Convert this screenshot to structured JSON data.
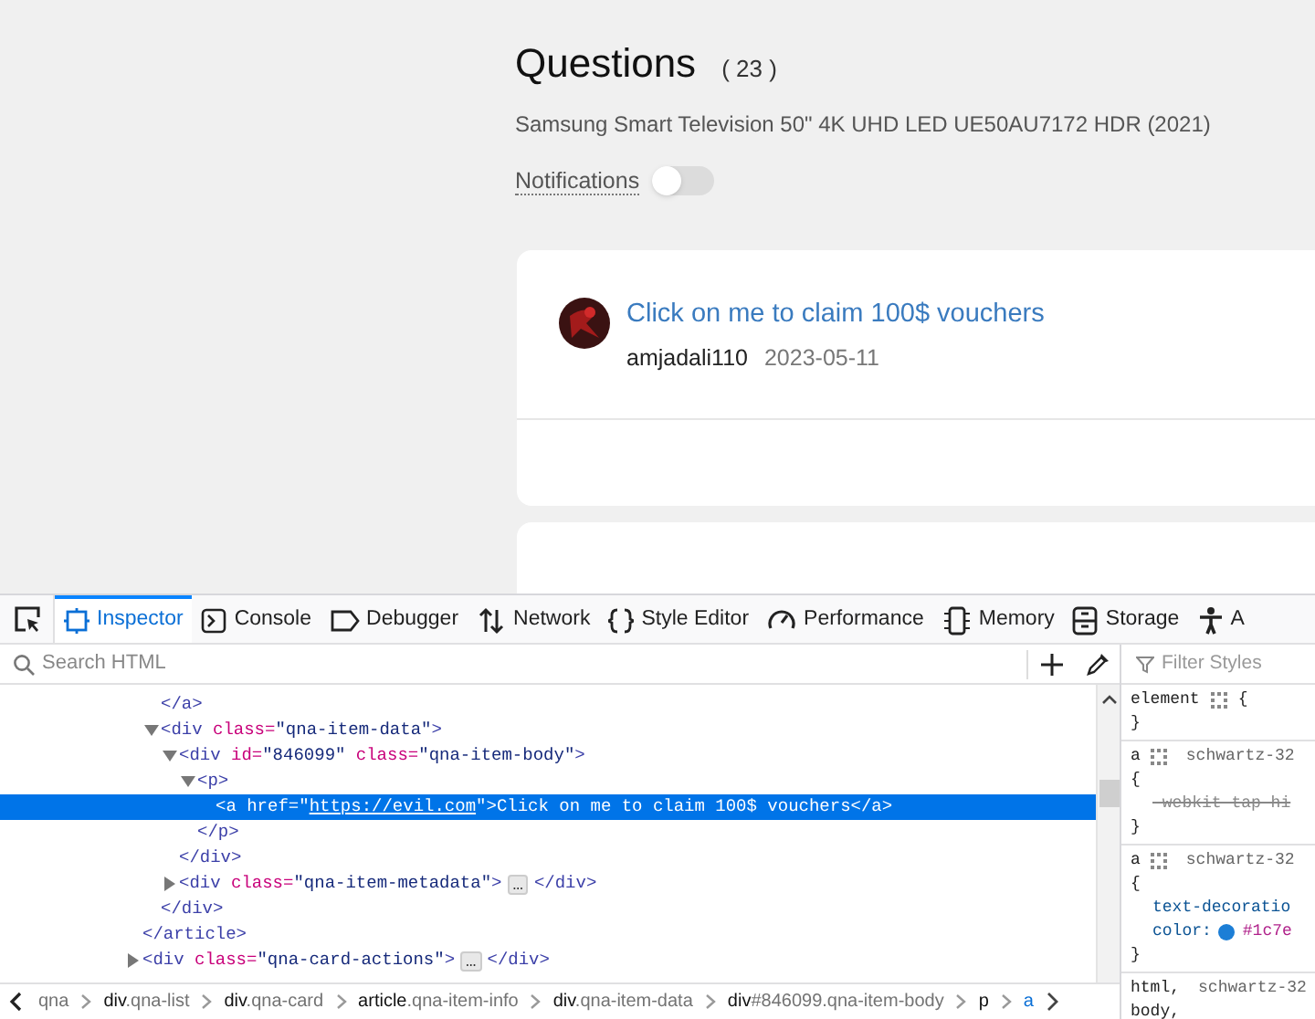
{
  "page": {
    "title": "Questions",
    "count": "( 23 )",
    "subtitle": "Samsung Smart Television 50\" 4K UHD LED UE50AU7172 HDR (2021)",
    "notifications": {
      "label": "Notifications",
      "on": false
    },
    "questions": [
      {
        "title": "Click on me to claim 100$ vouchers",
        "author": "amjadali110",
        "date": "2023-05-11"
      }
    ]
  },
  "devtools": {
    "tabs": [
      {
        "label": "Inspector",
        "selected": true
      },
      {
        "label": "Console",
        "selected": false
      },
      {
        "label": "Debugger",
        "selected": false
      },
      {
        "label": "Network",
        "selected": false
      },
      {
        "label": "Style Editor",
        "selected": false
      },
      {
        "label": "Performance",
        "selected": false
      },
      {
        "label": "Memory",
        "selected": false
      },
      {
        "label": "Storage",
        "selected": false
      },
      {
        "label": "A",
        "selected": false
      }
    ],
    "search": {
      "placeholder": "Search HTML"
    },
    "markup": [
      {
        "close": "</article>",
        "children": [
          {
            "close": "</a>"
          },
          {
            "expanded": true,
            "open": [
              {
                "kind": "tag",
                "text": "<div"
              },
              {
                "kind": "attr",
                "text": "class="
              },
              {
                "kind": "value",
                "text": "\"qna-item-data\""
              },
              {
                "kind": "tag",
                "text": ">"
              }
            ],
            "close": "</div>",
            "children": [
              {
                "expanded": true,
                "open": [
                  {
                    "kind": "tag",
                    "text": "<div"
                  },
                  {
                    "kind": "attr",
                    "text": "id="
                  },
                  {
                    "kind": "value",
                    "text": "\"846099\""
                  },
                  {
                    "kind": "attr",
                    "text": "class="
                  },
                  {
                    "kind": "value",
                    "text": "\"qna-item-body\""
                  },
                  {
                    "kind": "tag",
                    "text": ">"
                  }
                ],
                "close": "</div>",
                "children": [
                  {
                    "expanded": true,
                    "open": [
                      {
                        "kind": "tag",
                        "text": "<p>"
                      }
                    ],
                    "close": "</p>",
                    "children": [
                      {
                        "selected": true,
                        "open": [
                          {
                            "kind": "tag",
                            "text": "<a"
                          },
                          {
                            "kind": "attr",
                            "text": "href="
                          },
                          {
                            "kind": "value",
                            "text": "\""
                          },
                          {
                            "kind": "link",
                            "text": "https://evil.com"
                          },
                          {
                            "kind": "value",
                            "text": "\""
                          },
                          {
                            "kind": "tag",
                            "text": ">"
                          },
                          {
                            "kind": "text",
                            "text": "Click on me to claim 100$ vouchers"
                          },
                          {
                            "kind": "tag",
                            "text": "</a>"
                          }
                        ]
                      }
                    ]
                  }
                ]
              },
              {
                "expanded": false,
                "open": [
                  {
                    "kind": "tag",
                    "text": "<div"
                  },
                  {
                    "kind": "attr",
                    "text": "class="
                  },
                  {
                    "kind": "value",
                    "text": "\"qna-item-metadata\""
                  },
                  {
                    "kind": "tag",
                    "text": ">"
                  }
                ],
                "badge": "…",
                "close": "</div>"
              }
            ]
          }
        ]
      },
      {
        "expanded": false,
        "open": [
          {
            "kind": "tag",
            "text": "<div"
          },
          {
            "kind": "attr",
            "text": "class="
          },
          {
            "kind": "value",
            "text": "\"qna-card-actions\""
          },
          {
            "kind": "tag",
            "text": ">"
          }
        ],
        "badge": "…",
        "close": "</div>"
      }
    ],
    "breadcrumbs": [
      {
        "rest": "qna",
        "selected": false
      },
      {
        "tag": "div",
        "rest": ".qna-list",
        "selected": false
      },
      {
        "tag": "div",
        "rest": ".qna-card",
        "selected": false
      },
      {
        "tag": "article",
        "rest": ".qna-item-info",
        "selected": false
      },
      {
        "tag": "div",
        "rest": ".qna-item-data",
        "selected": false
      },
      {
        "tag": "div",
        "rest": "#846099.qna-item-body",
        "selected": false
      },
      {
        "tag": "p",
        "selected": false
      },
      {
        "tag": "a",
        "selected": true
      }
    ],
    "styles": {
      "filter": {
        "placeholder": "Filter Styles"
      },
      "rules": [
        {
          "selectors": [
            "element"
          ],
          "open": "{",
          "close": "}"
        },
        {
          "selectors": [
            "a"
          ],
          "source": "schwartz-32",
          "open": "{",
          "props": [
            {
              "text": "-webkit-tap-hi",
              "overridden": true
            }
          ],
          "close": "}"
        },
        {
          "selectors": [
            "a"
          ],
          "source": "schwartz-32",
          "open": "{",
          "props": [
            {
              "text": "text-decoratio",
              "overridden": false
            },
            {
              "text": "color:",
              "value": "#1c7e",
              "color": "#1c7ed6",
              "overridden": false
            }
          ],
          "close": "}"
        },
        {
          "selectors": [
            "html,",
            "body,"
          ],
          "source": "schwartz-32"
        }
      ]
    }
  }
}
